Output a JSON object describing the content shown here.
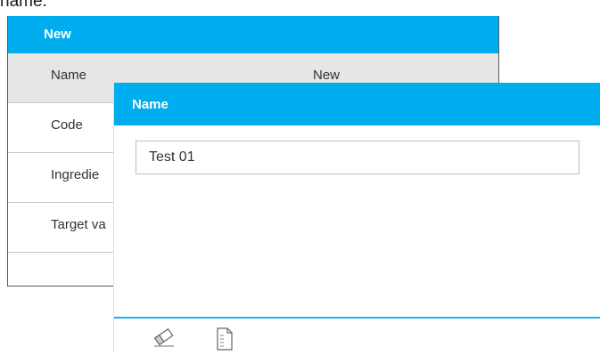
{
  "caption_fragment": "name.",
  "background_window": {
    "title": "New",
    "rows": [
      {
        "label": "Name",
        "value": "New"
      },
      {
        "label": "Code",
        "value": ""
      },
      {
        "label": "Ingredie",
        "value": ""
      },
      {
        "label": "Target va",
        "value": ""
      }
    ]
  },
  "dialog": {
    "title": "Name",
    "input_value": "Test 01"
  },
  "toolbar": {
    "icons": [
      "eraser-icon",
      "document-icon"
    ]
  },
  "colors": {
    "accent": "#00adef",
    "row_highlight": "#e6e6e6"
  }
}
